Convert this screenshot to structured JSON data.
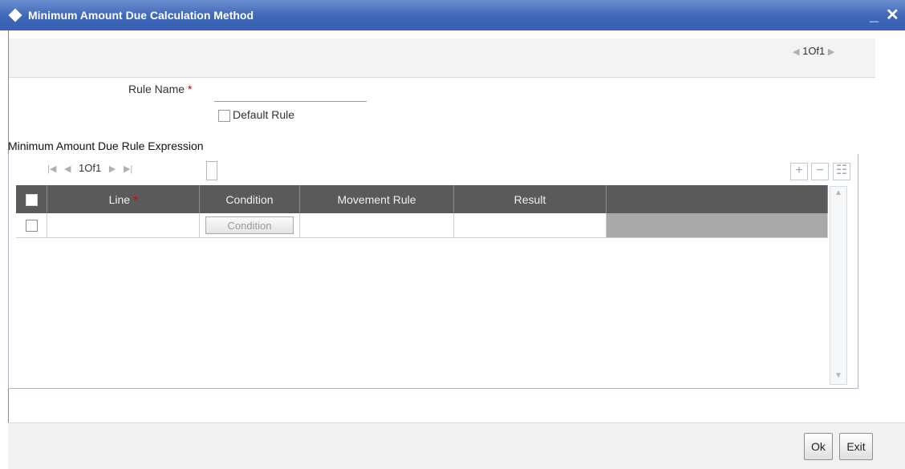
{
  "window": {
    "title": "Minimum Amount Due Calculation Method",
    "minimize_label": "_",
    "close_label": "✕"
  },
  "top_pager": {
    "prev_icon": "◀",
    "text": "1Of1",
    "next_icon": "▶"
  },
  "form": {
    "rule_name_label": "Rule Name",
    "required_marker": "*",
    "rule_name_value": "",
    "default_rule_label": "Default Rule",
    "default_rule_checked": false
  },
  "section": {
    "title": "Minimum Amount Due Rule Expression"
  },
  "grid_pager": {
    "first_icon": "|◀",
    "prev_icon": "◀",
    "text": "1Of1",
    "next_icon": "▶",
    "last_icon": "▶|"
  },
  "grid_toolbar": {
    "add_icon": "+",
    "delete_icon": "−",
    "view_icon": "☷"
  },
  "table": {
    "columns": [
      "Line",
      "Condition",
      "Movement Rule",
      "Result",
      ""
    ],
    "line_required_marker": "*",
    "rows": [
      {
        "line": "",
        "condition_button": "Condition",
        "movement_rule": "",
        "result": ""
      }
    ]
  },
  "footer": {
    "ok_label": "Ok",
    "exit_label": "Exit"
  }
}
